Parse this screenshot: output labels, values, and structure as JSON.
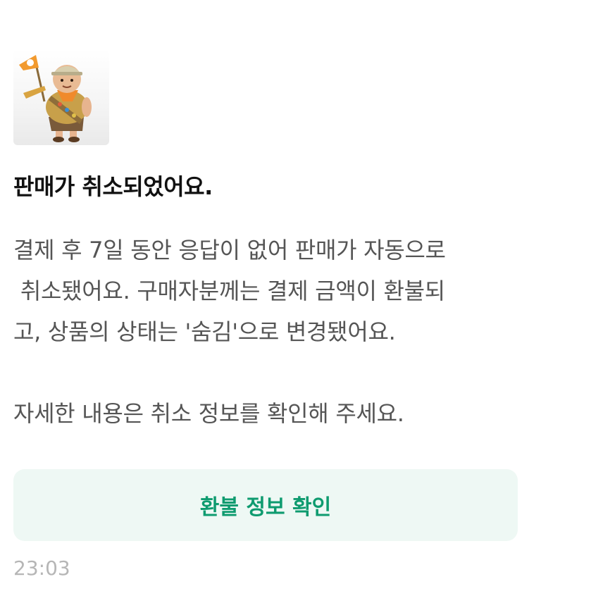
{
  "message": {
    "thumbnail_icon": "scout-character-image",
    "title": "판매가 취소되었어요.",
    "body_lines": [
      "결제 후 7일 동안 응답이 없어 판매가 자동으로",
      " 취소됐어요. 구매자분께는 결제 금액이 환불되",
      "고, 상품의 상태는 '숨김'으로 변경됐어요.",
      "",
      "자세한 내용은 취소 정보를 확인해 주세요."
    ],
    "button_label": "환불 정보 확인",
    "timestamp": "23:03"
  },
  "colors": {
    "button_bg": "#eef8f4",
    "button_text": "#0e9b6f",
    "body_text": "#555555",
    "title_text": "#111111",
    "timestamp_text": "#b6b6b6"
  }
}
